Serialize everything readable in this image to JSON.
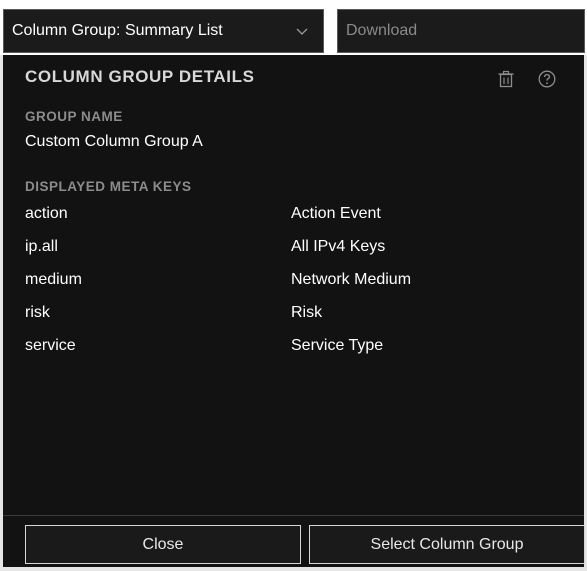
{
  "toolbar": {
    "column_group_select": "Column Group: Summary List",
    "download_placeholder": "Download"
  },
  "panel": {
    "title": "COLUMN GROUP DETAILS",
    "group_name_label": "GROUP NAME",
    "group_name_value": "Custom Column Group A",
    "meta_keys_label": "DISPLAYED META KEYS",
    "meta_keys": [
      {
        "key": "action",
        "description": "Action Event"
      },
      {
        "key": "ip.all",
        "description": "All IPv4 Keys"
      },
      {
        "key": "medium",
        "description": "Network Medium"
      },
      {
        "key": "risk",
        "description": "Risk"
      },
      {
        "key": "service",
        "description": "Service Type"
      }
    ]
  },
  "footer": {
    "close_label": "Close",
    "select_label": "Select Column Group"
  },
  "icons": {
    "delete": "trash-icon",
    "help": "help-icon",
    "dropdown": "chevron-down-icon"
  },
  "colors": {
    "panel_background": "#121212",
    "control_background": "#1b1b1b",
    "label_gray": "#8c8c8c",
    "text": "#ffffff"
  }
}
